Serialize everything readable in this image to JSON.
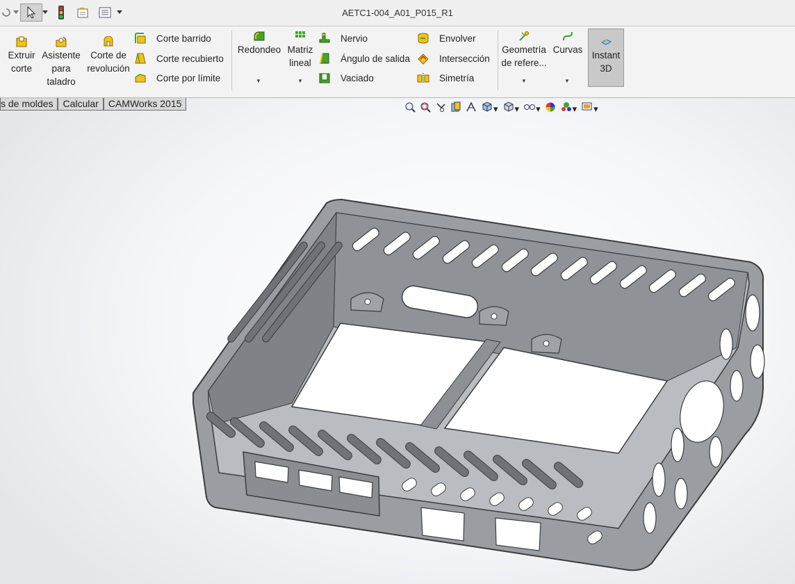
{
  "window": {
    "title": "AETC1-004_A01_P015_R1"
  },
  "quick_access": {
    "icons": [
      "select-pointer-icon",
      "rebuild-traffic-light-icon",
      "file-properties-icon",
      "options-list-icon"
    ]
  },
  "ribbon": {
    "big_buttons": {
      "extruir_corte": "Extruir\ncorte",
      "asistente_taladro": "Asistente\npara\ntaladro",
      "corte_revolucion": "Corte de\nrevolución",
      "redondeo": "Redondeo",
      "matriz_lineal": "Matriz\nlineal",
      "geometria_referencia": "Geometría\nde refere...",
      "curvas": "Curvas",
      "instant_3d": "Instant\n3D"
    },
    "col1": [
      "Corte barrido",
      "Corte recubierto",
      "Corte por límite"
    ],
    "col2": [
      "Nervio",
      "Ángulo de salida",
      "Vaciado"
    ],
    "col3": [
      "Envolver",
      "Intersección",
      "Simetría"
    ]
  },
  "tabs": [
    "s de moldes",
    "Calcular",
    "CAMWorks 2015"
  ],
  "view_toolbar": {
    "icons": [
      "zoom-to-fit-icon",
      "zoom-to-area-icon",
      "previous-view-icon",
      "section-view-icon",
      "dynamic-annotation-icon",
      "view-orientation-icon",
      "display-style-icon",
      "hide-show-items-icon",
      "edit-appearance-icon",
      "apply-scene-icon",
      "view-settings-icon"
    ]
  },
  "model": {
    "name": "enclosure-3d-model"
  },
  "colors": {
    "accent_yellow": "#f2c21a",
    "accent_green": "#46a32c",
    "model_gray": "#8c8f93",
    "instant3d_bg": "#c9c9c9"
  }
}
